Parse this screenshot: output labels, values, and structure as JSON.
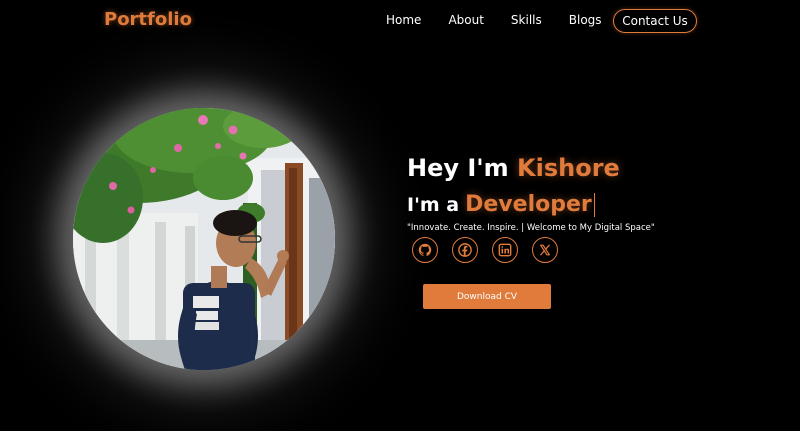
{
  "logo": "Portfolio",
  "nav": {
    "items": [
      {
        "label": "Home"
      },
      {
        "label": "About"
      },
      {
        "label": "Skills"
      },
      {
        "label": "Blogs"
      }
    ],
    "contact_label": "Contact Us"
  },
  "hero": {
    "greeting_prefix": "Hey I'm",
    "name": "Kishore",
    "role_prefix": "I'm a",
    "role": "Developer",
    "tagline": "\"Innovate. Create. Inspire. | Welcome to My Digital Space\"",
    "cv_button": "Download CV",
    "socials": [
      {
        "icon": "github-icon"
      },
      {
        "icon": "facebook-icon"
      },
      {
        "icon": "linkedin-icon"
      },
      {
        "icon": "x-icon"
      }
    ]
  },
  "colors": {
    "accent": "#e07b3c",
    "background": "#000000",
    "text": "#ffffff"
  }
}
